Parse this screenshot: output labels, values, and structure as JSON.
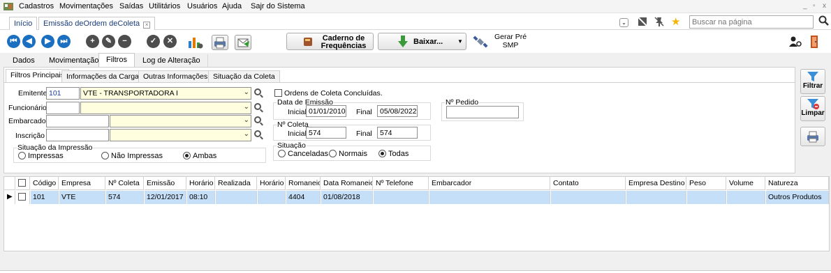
{
  "menubar": {
    "items": [
      "Cadastros",
      "Movimentações",
      "Saídas",
      "Utilitários",
      "Usuários",
      "Ajuda",
      "Sajr do Sistema"
    ],
    "window_controls": [
      "_",
      "▫",
      "x"
    ]
  },
  "doc_tabs": [
    {
      "label": "Início"
    },
    {
      "label": "Emissão deOrdem deColeta"
    }
  ],
  "search": {
    "placeholder": "Buscar na página"
  },
  "toolbar": {
    "caderno": "Caderno de Frequências",
    "baixar": "Baixar...",
    "gerar": "Gerar Pré SMP"
  },
  "main_tabs": [
    "Dados",
    "Movimentação",
    "Filtros",
    "Log de Alteração"
  ],
  "sub_tabs": [
    "Filtros Principais",
    "Informações da Carga",
    "Outras Informações",
    "Situação da Coleta"
  ],
  "filters": {
    "emitente_label": "Emitente",
    "emitente_code": "101",
    "emitente_name": "VTE - TRANSPORTADORA I",
    "funcionario_label": "Funcionário",
    "embarcador_label": "Embarcador",
    "inscricao_label": "Inscrição",
    "situacao_impressao": {
      "title": "Situação da Impressão",
      "options": [
        "Impressas",
        "Não Impressas",
        "Ambas"
      ],
      "selected": "Ambas"
    },
    "ordens_concluidas": "Ordens de Coleta Concluídas.",
    "data_emissao": {
      "title": "Data de Emissão",
      "inicial_label": "Inicial",
      "inicial": "01/01/2010",
      "final_label": "Final",
      "final": "05/08/2022"
    },
    "n_coleta": {
      "title": "Nº Coleta",
      "inicial_label": "Inicial",
      "inicial": "574",
      "final_label": "Final",
      "final": "574"
    },
    "n_pedido": {
      "title": "Nº Pedido",
      "value": ""
    },
    "situacao": {
      "title": "Situação",
      "options": [
        "Canceladas",
        "Normais",
        "Todas"
      ],
      "selected": "Todas"
    }
  },
  "side_buttons": {
    "filtrar": "Filtrar",
    "limpar": "Limpar"
  },
  "grid": {
    "columns": [
      "Código",
      "Empresa",
      "Nº Coleta",
      "Emissão",
      "Horário",
      "Realizada",
      "Horário",
      "Romaneio",
      "Data Romaneio",
      "Nº Telefone",
      "Embarcador",
      "Contato",
      "Empresa Destino",
      "Peso",
      "Volume",
      "Natureza"
    ],
    "rows": [
      [
        "101",
        "VTE",
        "574",
        "12/01/2017",
        "08:10",
        "",
        "",
        "4404",
        "01/08/2018",
        "",
        "",
        "",
        "",
        "",
        "",
        "Outros Produtos"
      ]
    ]
  },
  "colors": {
    "accent_blue": "#1b6fc1",
    "selected_row": "#c5dff8",
    "highlight_field": "#ffffe0"
  }
}
